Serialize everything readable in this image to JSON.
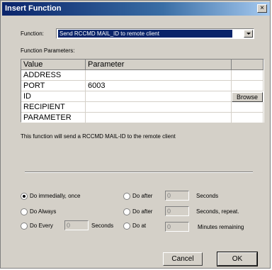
{
  "window": {
    "title": "Insert Function"
  },
  "function": {
    "label": "Function:",
    "selected": "Send RCCMD MAIL_ID to remote client"
  },
  "params": {
    "label": "Function Parameters:",
    "headers": [
      "Value",
      "Parameter"
    ],
    "rows": [
      {
        "value": "ADDRESS",
        "parameter": ""
      },
      {
        "value": "PORT",
        "parameter": "6003"
      },
      {
        "value": "ID",
        "parameter": ""
      },
      {
        "value": "RECIPIENT",
        "parameter": ""
      },
      {
        "value": "PARAMETER",
        "parameter": ""
      }
    ],
    "browse_label": "Browse"
  },
  "description": "This function will send a RCCMD MAIL-ID to the remote client",
  "schedule": {
    "immediately": "Do immedially, once",
    "always": "Do Always",
    "every": "Do Every",
    "every_value": "0",
    "every_unit": "Seconds",
    "after1": "Do after",
    "after1_value": "0",
    "after1_unit": "Seconds",
    "after2": "Do after",
    "after2_value": "0",
    "after2_unit": "Seconds, repeat.",
    "at": "Do at",
    "at_value": "0",
    "at_unit": "Minutes remaining"
  },
  "buttons": {
    "cancel": "Cancel",
    "ok": "OK"
  }
}
